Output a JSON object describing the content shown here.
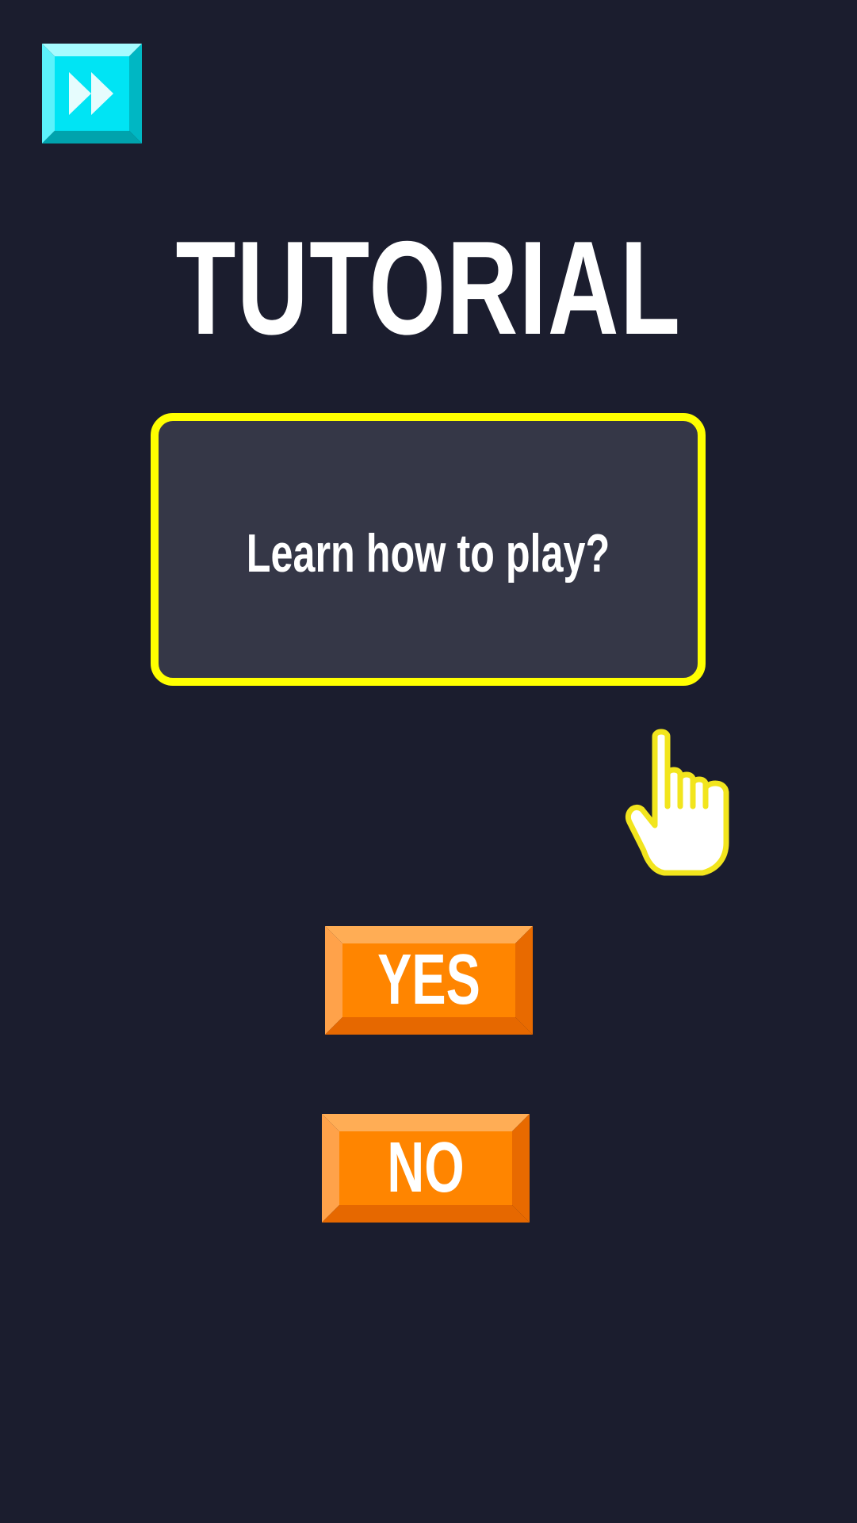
{
  "screen": {
    "title": "TUTORIAL",
    "prompt": "Learn how to play?"
  },
  "skip": {
    "icon": "fast-forward-icon"
  },
  "buttons": {
    "yes_label": "YES",
    "no_label": "NO"
  },
  "pointer": {
    "icon": "pointing-hand-icon"
  },
  "colors": {
    "background": "#1b1d2e",
    "panel": "#353747",
    "highlight_border": "#ffff00",
    "button_orange": "#ff8500",
    "skip_cyan": "#00e4f4"
  }
}
